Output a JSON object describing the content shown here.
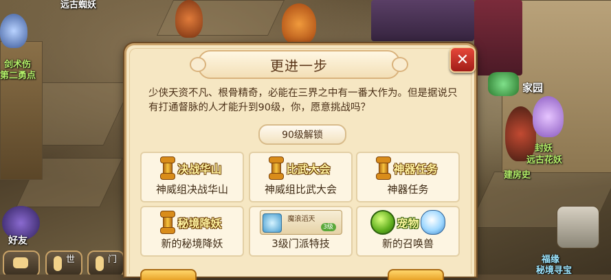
{
  "hud": {
    "npc_names": {
      "top_left": "远古蜘妖",
      "left_1": "剑术伤",
      "left_2": "第二勇点",
      "home": "家园",
      "demon": "封妖",
      "ancient_flower": "远古花妖",
      "builder": "建房史",
      "bottom_right_1": "福缘",
      "bottom_right_2": "秘境寻宝"
    },
    "friends_label": "好友",
    "world_label": "世",
    "voice_label": "门"
  },
  "dialog": {
    "title": "更进一步",
    "close_symbol": "✕",
    "description": "少侠天资不凡、根骨精奇，必能在三界之中有一番大作为。但是据说只有打通督脉的人才能升到90级，你，愿意挑战吗？",
    "unlock_label": "90级解锁",
    "features": [
      {
        "banner": "决战华山",
        "caption": "神威组决战华山",
        "icon": "scroll-icon"
      },
      {
        "banner": "比武大会",
        "caption": "神威组比武大会",
        "icon": "scroll-icon"
      },
      {
        "banner": "神器任务",
        "caption": "神器任务",
        "icon": "scroll-icon"
      },
      {
        "banner": "秘境降妖",
        "caption": "新的秘境降妖",
        "icon": "scroll-icon"
      },
      {
        "skill_name": "魔浪滔天",
        "skill_level": "3级",
        "caption": "3级门派特技",
        "icon": "skill-icon"
      },
      {
        "banner": "宠物",
        "caption": "新的召唤兽",
        "icon": "pet-icon"
      }
    ]
  },
  "colors": {
    "dialog_bg": "#f6e7c3",
    "dialog_border": "#caa26a",
    "close_red": "#c8332a",
    "banner_gold": "#fff3a0",
    "text_brown": "#4a2f17"
  }
}
